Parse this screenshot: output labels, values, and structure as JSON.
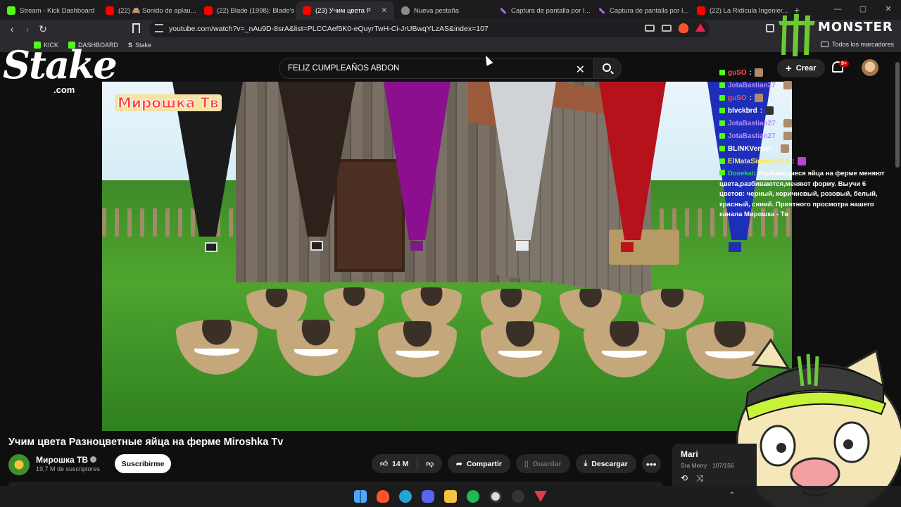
{
  "browser": {
    "tabs": [
      {
        "label": "Stream - Kick Dashboard",
        "icon": "kick-icon"
      },
      {
        "label": "(22) 🙈 Sonido de aplau...",
        "icon": "youtube-icon"
      },
      {
        "label": "(22) Blade (1998): Blade's",
        "icon": "youtube-icon"
      },
      {
        "label": "(23) Учим цвета Р",
        "icon": "youtube-icon",
        "active": true
      },
      {
        "label": "Nueva pestaña",
        "icon": "brave-icon"
      },
      {
        "label": "Captura de pantalla por I...",
        "icon": "pen-icon"
      },
      {
        "label": "Captura de pantalla por I...",
        "icon": "pen-icon"
      },
      {
        "label": "(22) La Ridícula Ingenier...",
        "icon": "youtube-icon"
      }
    ],
    "url": "youtube.com/watch?v=_nAu9D-8srA&list=PLCCAef5K0-eQuyrTwH-Ci-JrUBwqYLzAS&index=107",
    "bookmarks": [
      "KICK",
      "DASHBOARD",
      "Stake"
    ],
    "all_bookmarks_label": "Todos los marcadores"
  },
  "youtube": {
    "search_value": "FELIZ CUMPLEAÑOS ABDON",
    "create_label": "Crear",
    "notif_badge": "9+",
    "video_overlay_logo": "Мирошка Тв",
    "video_title": "Учим цвета Разноцветные яйца на ферме Miroshka Tv",
    "channel_name": "Мирошка ТВ",
    "channel_subs": "19,7 M de suscriptores",
    "subscribe_label": "Suscribirme",
    "like_count": "14 M",
    "share_label": "Compartir",
    "save_label": "Guardar",
    "download_label": "Descargar",
    "playlist": {
      "title": "Mari",
      "sub": "Sra Merry · 107/156"
    }
  },
  "stream_overlay": {
    "stake_word": "Stake",
    "stake_com": ".com",
    "monster_text": "MONSTER",
    "chat": [
      {
        "user": "guSO",
        "color": "#ff4d4d",
        "text": ":"
      },
      {
        "user": "JotaBastian27",
        "color": "#b48cff",
        "text": ":"
      },
      {
        "user": "guSO",
        "color": "#ff4d4d",
        "text": ":"
      },
      {
        "user": "blvckbrd",
        "color": "#ffffff",
        "text": ":"
      },
      {
        "user": "JotaBastian27",
        "color": "#b48cff",
        "text": ":"
      },
      {
        "user": "JotaBastian27",
        "color": "#b48cff",
        "text": ":"
      },
      {
        "user": "BLINKVenom",
        "color": "#ffffff",
        "text": ":"
      },
      {
        "user": "ElMataSimios1616",
        "color": "#f5e663",
        "text": ":"
      }
    ],
    "chat_long_user": "Dosekai",
    "chat_long_text": ": Улыбающиеся яйца на ферме меняют цвета,разбиваются,меняют форму. Выучи 6 цветов: черный, коричневый, розовый, белый, красный, синий. Приятного просмотра нашего канала Мирошка - Тв"
  }
}
